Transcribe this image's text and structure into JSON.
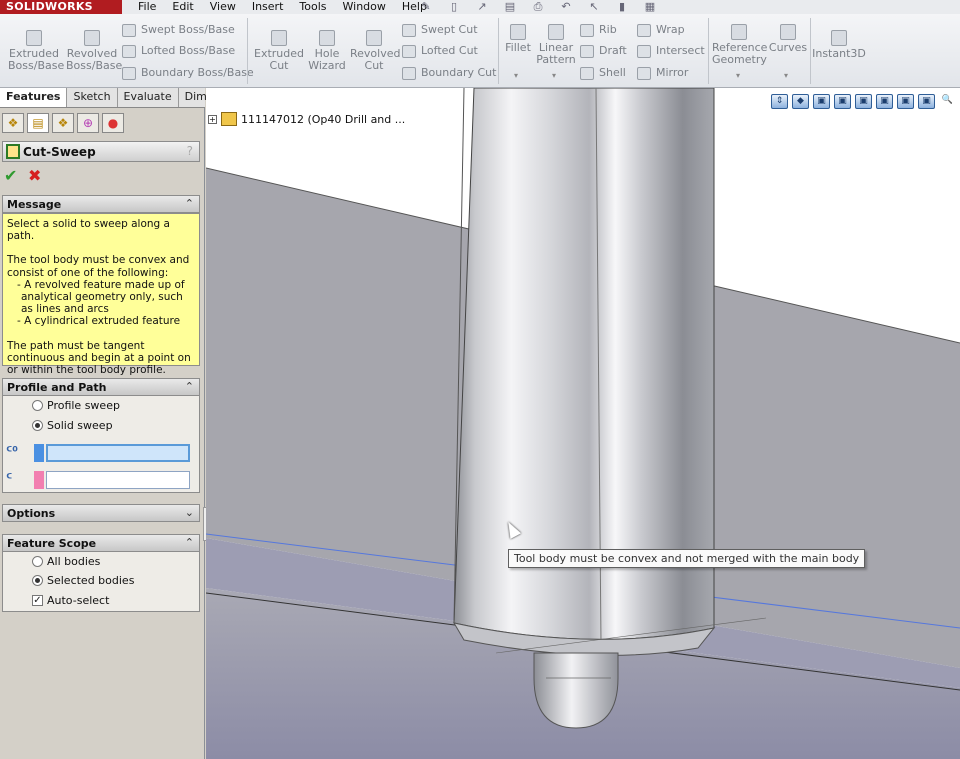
{
  "app": {
    "brand": "SOLIDWORKS",
    "menu": [
      "File",
      "Edit",
      "View",
      "Insert",
      "Tools",
      "Window",
      "Help"
    ]
  },
  "command_manager": {
    "large_tools": [
      {
        "id": "extruded-boss",
        "lines": [
          "Extruded",
          "Boss/Base"
        ]
      },
      {
        "id": "revolved-boss",
        "lines": [
          "Revolved",
          "Boss/Base"
        ]
      },
      {
        "id": "extruded-cut",
        "lines": [
          "Extruded",
          "Cut"
        ]
      },
      {
        "id": "hole-wizard",
        "lines": [
          "Hole",
          "Wizard"
        ]
      },
      {
        "id": "revolved-cut",
        "lines": [
          "Revolved",
          "Cut"
        ]
      },
      {
        "id": "fillet",
        "lines": [
          "Fillet",
          ""
        ]
      },
      {
        "id": "linear-pattern",
        "lines": [
          "Linear",
          "Pattern"
        ]
      },
      {
        "id": "reference-geometry",
        "lines": [
          "Reference",
          "Geometry"
        ]
      },
      {
        "id": "curves",
        "lines": [
          "Curves",
          ""
        ]
      },
      {
        "id": "instant3d",
        "lines": [
          "Instant3D",
          ""
        ]
      }
    ],
    "small_tools": {
      "swept_boss": "Swept Boss/Base",
      "lofted_boss": "Lofted Boss/Base",
      "boundary_boss": "Boundary Boss/Base",
      "swept_cut": "Swept Cut",
      "lofted_cut": "Lofted Cut",
      "boundary_cut": "Boundary Cut",
      "rib": "Rib",
      "draft": "Draft",
      "shell": "Shell",
      "wrap": "Wrap",
      "intersect": "Intersect",
      "mirror": "Mirror"
    }
  },
  "tabs": [
    "Features",
    "Sketch",
    "Evaluate",
    "DimXpert"
  ],
  "property_manager": {
    "title": "Cut-Sweep",
    "help": "?",
    "ok": "✔",
    "cancel": "✖",
    "message": {
      "header": "Message",
      "line1": "Select a solid to sweep along a path.",
      "line2": "The tool body must be convex and consist of one of the following:",
      "line3": "- A revolved feature made up of analytical geometry only, such as lines and arcs",
      "line4": "- A cylindrical extruded feature",
      "line5": "The path must be tangent continuous and begin at a point on or within the tool body profile."
    },
    "profile_path": {
      "header": "Profile and Path",
      "option1": "Profile sweep",
      "option2": "Solid sweep",
      "selected": "Solid sweep",
      "box1_color": "#4a90e2",
      "box2_color": "#f27fb0"
    },
    "options": {
      "header": "Options"
    },
    "feature_scope": {
      "header": "Feature Scope",
      "option1": "All bodies",
      "option2": "Selected bodies",
      "selected": "Selected bodies",
      "auto_select": "Auto-select",
      "auto_select_checked": true
    }
  },
  "graphics": {
    "tree_label": "111147012  (Op40 Drill and ...",
    "tooltip": "Tool body must be convex and not merged with the main body"
  }
}
